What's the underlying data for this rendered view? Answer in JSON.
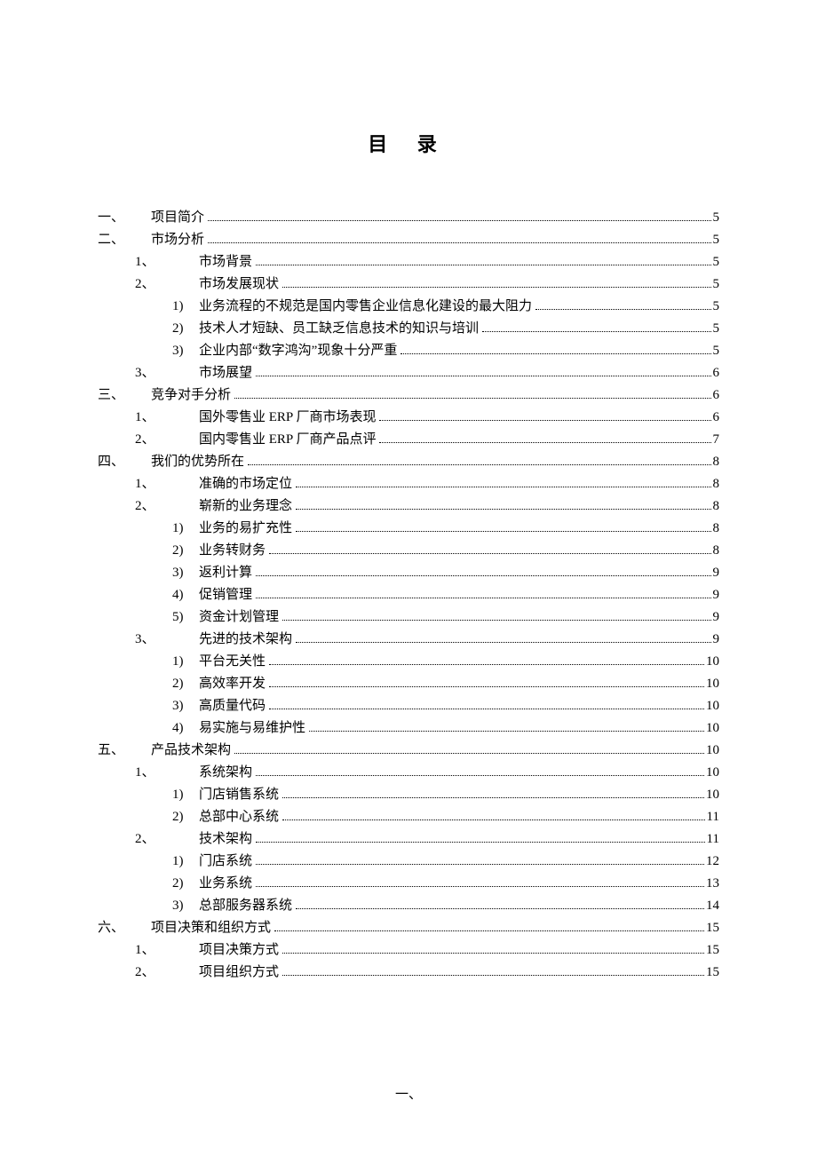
{
  "title": "目 录",
  "footer": "一、",
  "toc": [
    {
      "lvl": 1,
      "marker": "一、",
      "title": "项目简介",
      "page": "5"
    },
    {
      "lvl": 1,
      "marker": "二、",
      "title": "市场分析",
      "page": "5"
    },
    {
      "lvl": 2,
      "marker": "1、",
      "title": "市场背景",
      "page": "5"
    },
    {
      "lvl": 2,
      "marker": "2、",
      "title": "市场发展现状",
      "page": "5"
    },
    {
      "lvl": 3,
      "marker": "1)",
      "title": "业务流程的不规范是国内零售企业信息化建设的最大阻力",
      "page": "5"
    },
    {
      "lvl": 3,
      "marker": "2)",
      "title": "技术人才短缺、员工缺乏信息技术的知识与培训",
      "page": "5"
    },
    {
      "lvl": 3,
      "marker": "3)",
      "title": "企业内部“数字鸿沟”现象十分严重",
      "page": "5"
    },
    {
      "lvl": 2,
      "marker": "3、",
      "title": "市场展望",
      "page": "6"
    },
    {
      "lvl": 1,
      "marker": "三、",
      "title": "竞争对手分析",
      "page": "6"
    },
    {
      "lvl": 2,
      "marker": "1、",
      "title": "国外零售业 ERP 厂商市场表现",
      "page": "6"
    },
    {
      "lvl": 2,
      "marker": "2、",
      "title": "国内零售业 ERP 厂商产品点评",
      "page": "7"
    },
    {
      "lvl": 1,
      "marker": "四、",
      "title": "我们的优势所在",
      "page": "8"
    },
    {
      "lvl": 2,
      "marker": "1、",
      "title": "准确的市场定位",
      "page": "8"
    },
    {
      "lvl": 2,
      "marker": "2、",
      "title": "崭新的业务理念",
      "page": "8"
    },
    {
      "lvl": 3,
      "marker": "1)",
      "title": "业务的易扩充性",
      "page": "8"
    },
    {
      "lvl": 3,
      "marker": "2)",
      "title": "业务转财务",
      "page": "8"
    },
    {
      "lvl": 3,
      "marker": "3)",
      "title": "返利计算",
      "page": "9"
    },
    {
      "lvl": 3,
      "marker": "4)",
      "title": "促销管理",
      "page": "9"
    },
    {
      "lvl": 3,
      "marker": "5)",
      "title": "资金计划管理",
      "page": "9"
    },
    {
      "lvl": 2,
      "marker": "3、",
      "title": "先进的技术架构",
      "page": "9"
    },
    {
      "lvl": 3,
      "marker": "1)",
      "title": "平台无关性",
      "page": "10"
    },
    {
      "lvl": 3,
      "marker": "2)",
      "title": "高效率开发",
      "page": "10"
    },
    {
      "lvl": 3,
      "marker": "3)",
      "title": "高质量代码",
      "page": "10"
    },
    {
      "lvl": 3,
      "marker": "4)",
      "title": "易实施与易维护性",
      "page": "10"
    },
    {
      "lvl": 1,
      "marker": "五、",
      "title": "产品技术架构",
      "page": "10"
    },
    {
      "lvl": 2,
      "marker": "1、",
      "title": "系统架构",
      "page": "10"
    },
    {
      "lvl": 3,
      "marker": "1)",
      "title": "门店销售系统",
      "page": "10"
    },
    {
      "lvl": 3,
      "marker": "2)",
      "title": "总部中心系统",
      "page": "11"
    },
    {
      "lvl": 2,
      "marker": "2、",
      "title": "技术架构",
      "page": "11"
    },
    {
      "lvl": 3,
      "marker": "1)",
      "title": "门店系统",
      "page": "12"
    },
    {
      "lvl": 3,
      "marker": "2)",
      "title": "业务系统",
      "page": "13"
    },
    {
      "lvl": 3,
      "marker": "3)",
      "title": "总部服务器系统",
      "page": "14"
    },
    {
      "lvl": 1,
      "marker": "六、",
      "title": "项目决策和组织方式",
      "page": "15"
    },
    {
      "lvl": 2,
      "marker": "1、",
      "title": "项目决策方式",
      "page": "15"
    },
    {
      "lvl": 2,
      "marker": "2、",
      "title": "项目组织方式",
      "page": "15"
    }
  ]
}
